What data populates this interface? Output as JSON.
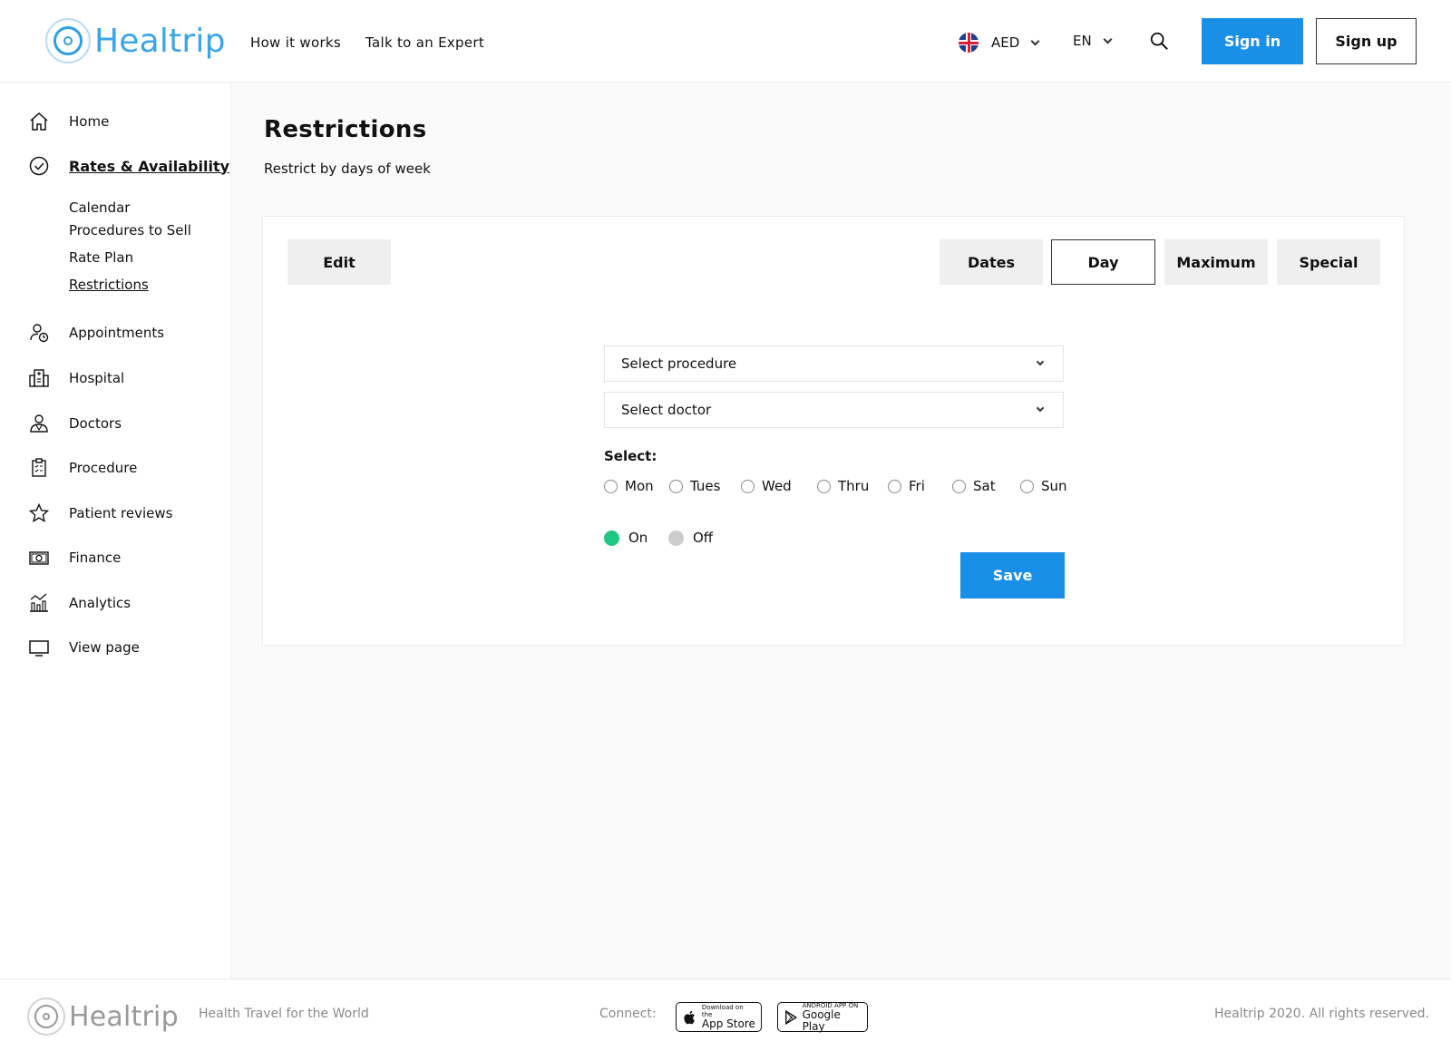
{
  "brand": {
    "name": "Healtrip"
  },
  "header": {
    "nav": [
      {
        "label": "How it works"
      },
      {
        "label": "Talk to an Expert"
      }
    ],
    "currency": "AED",
    "language": "EN",
    "sign_in": "Sign in",
    "sign_up": "Sign up"
  },
  "sidebar": {
    "items": [
      {
        "label": "Home",
        "icon": "home-icon"
      },
      {
        "label": "Rates & Availability",
        "icon": "check-circle-icon"
      },
      {
        "label": "Appointments",
        "icon": "user-clock-icon"
      },
      {
        "label": "Hospital",
        "icon": "building-icon"
      },
      {
        "label": "Doctors",
        "icon": "doctor-icon"
      },
      {
        "label": "Procedure",
        "icon": "clipboard-icon"
      },
      {
        "label": "Patient reviews",
        "icon": "star-icon"
      },
      {
        "label": "Finance",
        "icon": "money-icon"
      },
      {
        "label": "Analytics",
        "icon": "chart-icon"
      },
      {
        "label": "View page",
        "icon": "monitor-icon"
      }
    ],
    "sub_items": [
      {
        "label": "Calendar"
      },
      {
        "label": "Procedures to Sell"
      },
      {
        "label": "Rate Plan"
      },
      {
        "label": "Restrictions"
      }
    ]
  },
  "main": {
    "title": "Restrictions",
    "subtitle": "Restrict by days of week",
    "edit_label": "Edit",
    "tabs": [
      {
        "label": "Dates"
      },
      {
        "label": "Day"
      },
      {
        "label": "Maximum"
      },
      {
        "label": "Special"
      }
    ],
    "procedure_select": "Select procedure",
    "doctor_select": "Select doctor",
    "select_label": "Select:",
    "days": [
      "Mon",
      "Tues",
      "Wed",
      "Thru",
      "Fri",
      "Sat",
      "Sun"
    ],
    "on_label": "On",
    "off_label": "Off",
    "save_label": "Save"
  },
  "footer": {
    "tagline": "Health Travel for the World",
    "connect": "Connect:",
    "app_store_small": "Download on the",
    "app_store_big": "App Store",
    "google_small": "ANDROID APP ON",
    "google_big": "Google Play",
    "copyright": "Healtrip 2020. All rights reserved."
  },
  "colors": {
    "accent": "#1a8fe8",
    "on": "#1fc782",
    "off": "#cccccc"
  }
}
